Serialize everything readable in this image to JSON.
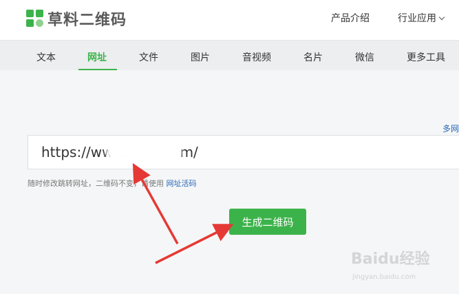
{
  "header": {
    "logo_text": "草料二维码",
    "nav": [
      "产品介绍",
      "行业应用"
    ]
  },
  "tabs": [
    "文本",
    "网址",
    "文件",
    "图片",
    "音视频",
    "名片",
    "微信",
    "更多工具"
  ],
  "active_tab": "网址",
  "multi_link": "多网",
  "input": {
    "value": "https://www.            m/"
  },
  "hint": {
    "text": "随时修改跳转网址，二维码不变，请使用",
    "link": "网址活码"
  },
  "generate_button": "生成二维码",
  "watermark": {
    "main": "Baidu经验",
    "sub": "jingyan.baidu.com"
  },
  "colors": {
    "accent": "#3cb34a",
    "link": "#2a6ab8",
    "arrow": "#e53935"
  }
}
